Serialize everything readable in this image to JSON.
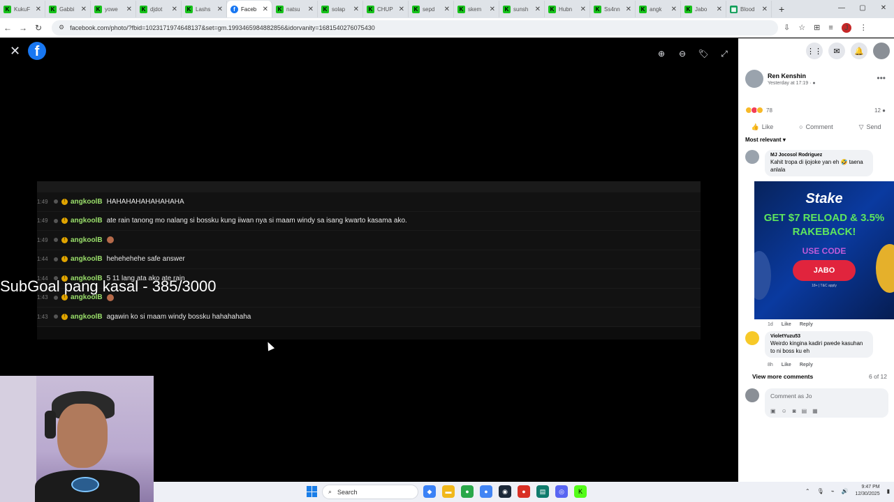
{
  "browser": {
    "tabs": [
      {
        "label": "KukuF",
        "icon": "kick-icon"
      },
      {
        "label": "Gabbi",
        "icon": "kick-icon"
      },
      {
        "label": "yowe",
        "icon": "kick-icon"
      },
      {
        "label": "djdot",
        "icon": "kick-icon"
      },
      {
        "label": "Lashs",
        "icon": "kick-icon"
      },
      {
        "label": "Faceb",
        "icon": "facebook-icon",
        "active": true
      },
      {
        "label": "natsu",
        "icon": "kick-icon"
      },
      {
        "label": "solap",
        "icon": "kick-icon"
      },
      {
        "label": "CHUP",
        "icon": "kick-icon"
      },
      {
        "label": "sepd",
        "icon": "kick-icon"
      },
      {
        "label": "skem",
        "icon": "kick-icon"
      },
      {
        "label": "sunsh",
        "icon": "kick-icon"
      },
      {
        "label": "Hubn",
        "icon": "kick-icon"
      },
      {
        "label": "Ss4nn",
        "icon": "kick-icon"
      },
      {
        "label": "angk",
        "icon": "kick-icon"
      },
      {
        "label": "Jabo",
        "icon": "kick-icon"
      },
      {
        "label": "Blood",
        "icon": "sheets-icon"
      }
    ],
    "url": "facebook.com/photo/?fbid=1023171974648137&set=gm.1993465984882856&idorvanity=1681540276075430",
    "profile_initial": "J"
  },
  "viewer": {
    "chat": [
      {
        "time": "1:49",
        "user": "angkoolB",
        "text": "HAHAHAHAHAHAHAHA"
      },
      {
        "time": "1:49",
        "user": "angkoolB",
        "text": "ate rain tanong mo nalang si bossku kung iiwan nya si maam windy sa isang kwarto kasama ako."
      },
      {
        "time": "1:49",
        "user": "angkoolB",
        "text": ""
      },
      {
        "time": "1:44",
        "user": "angkoolB",
        "text": "hehehehehe safe answer"
      },
      {
        "time": "1:44",
        "user": "angkoolB",
        "text": "5 11 lang ata ako ate rain"
      },
      {
        "time": "1:43",
        "user": "angkoolB",
        "text": ""
      },
      {
        "time": "1:43",
        "user": "angkoolB",
        "text": "agawin ko si maam windy bossku hahahahaha"
      }
    ],
    "overlay_text": "SubGoal pang kasal - 385/3000"
  },
  "sidebar": {
    "author": "Ren Kenshin",
    "posted": "Yesterday at 17:19 · ",
    "reaction_count": "78",
    "comment_count": "12",
    "actions": {
      "like": "Like",
      "comment": "Comment",
      "send": "Send"
    },
    "sort": "Most relevant",
    "comments": [
      {
        "author": "MJ Jocosol Rodriguez",
        "text": "Kahit tropa di ijojoke yan eh 🤣 taena anlala"
      },
      {
        "author": "VioletYuzu53",
        "text": "Weirdo kingina kadiri pwede kasuhan to ni boss ku eh",
        "age": "8h"
      }
    ],
    "hidden_meta": {
      "age": "1d",
      "like": "Like",
      "reply": "Reply"
    },
    "view_more": "View more comments",
    "page_count": "6 of 12",
    "compose_placeholder": "Comment as Jo"
  },
  "ad": {
    "brand": "Stake",
    "headline": "GET $7 RELOAD & 3.5% RAKEBACK!",
    "code_label": "USE CODE",
    "code": "JABO",
    "fine_print": "18+ | T&C apply"
  },
  "taskbar": {
    "search": "Search",
    "time": "9:47 PM",
    "date": "12/30/2025"
  }
}
